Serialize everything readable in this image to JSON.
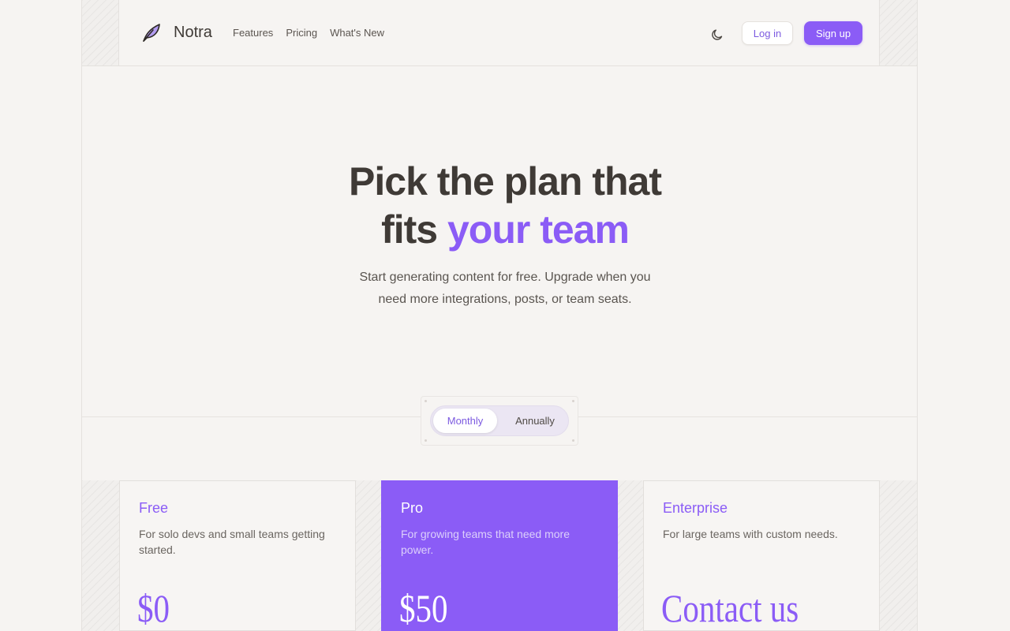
{
  "brand": {
    "name": "Notra",
    "logo_icon": "feather-icon"
  },
  "nav": {
    "links": [
      "Features",
      "Pricing",
      "What's New"
    ],
    "theme_icon": "moon-icon",
    "login_label": "Log in",
    "signup_label": "Sign up"
  },
  "hero": {
    "title_line1": "Pick the plan that",
    "title_line2_plain": "fits",
    "title_line2_accent": "your team",
    "subtitle_line1": "Start generating content for free. Upgrade when you",
    "subtitle_line2": "need more integrations, posts, or team seats."
  },
  "billing_toggle": {
    "options": [
      "Monthly",
      "Annually"
    ],
    "selected": "Monthly"
  },
  "plans": [
    {
      "name": "Free",
      "description": "For solo devs and small teams getting started.",
      "price": "$0"
    },
    {
      "name": "Pro",
      "description": "For growing teams that need more power.",
      "price": "$50"
    },
    {
      "name": "Enterprise",
      "description": "For large teams with custom needs.",
      "price": "Contact us"
    }
  ],
  "colors": {
    "accent": "#8b5cf6",
    "background": "#f6f4f2",
    "text": "#3f3a36"
  }
}
